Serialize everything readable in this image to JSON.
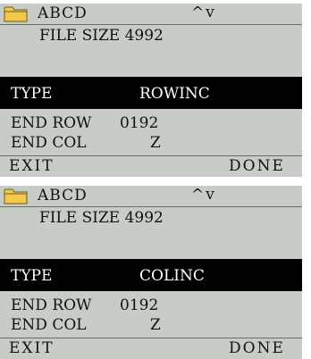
{
  "screens": [
    {
      "file_name": "ABCD",
      "scroll_indicator": "^v",
      "file_size": "FILE SIZE 4992",
      "type_label": "TYPE",
      "type_value": "ROWINC",
      "end_row_label": "END ROW",
      "end_row_value": "0192",
      "end_col_label": "END COL",
      "end_col_value": "Z",
      "exit_label": "EXIT",
      "done_label": "DONE"
    },
    {
      "file_name": "ABCD",
      "scroll_indicator": "^v",
      "file_size": "FILE SIZE 4992",
      "type_label": "TYPE",
      "type_value": "COLINC",
      "end_row_label": "END ROW",
      "end_row_value": "0192",
      "end_col_label": "END COL",
      "end_col_value": "Z",
      "exit_label": "EXIT",
      "done_label": "DONE"
    }
  ],
  "icons": {
    "folder": "folder-icon"
  },
  "colors": {
    "screen_background": "#c8ccc6",
    "selection_background": "#000000",
    "selection_text": "#ffffff",
    "folder_fill": "#f2c94c"
  }
}
